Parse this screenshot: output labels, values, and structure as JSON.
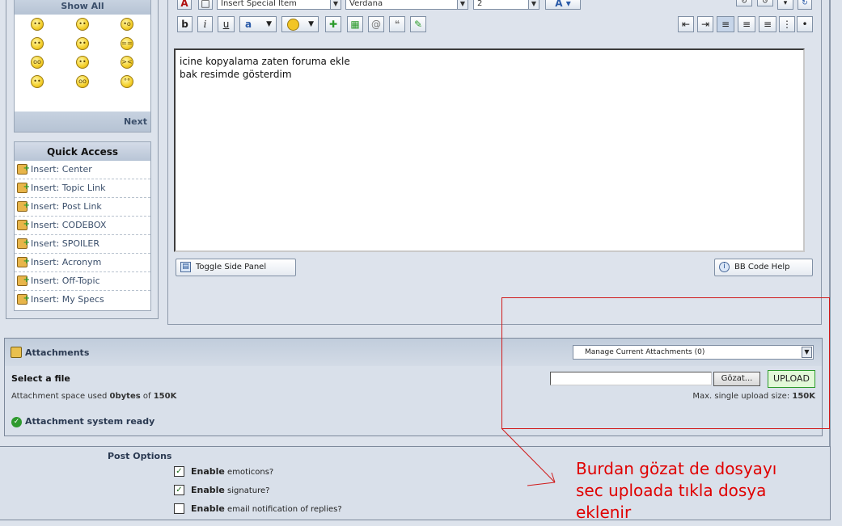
{
  "emoticons": {
    "show_all": "Show All",
    "next": "Next",
    "faces": [
      "••",
      "••",
      "•o",
      "••",
      "••",
      "==",
      "oo",
      "••",
      "><",
      "••",
      "oo",
      "°°"
    ]
  },
  "quick_access": {
    "title": "Quick Access",
    "items": [
      "Insert: Center",
      "Insert: Topic Link",
      "Insert: Post Link",
      "Insert: CODEBOX",
      "Insert: SPOILER",
      "Insert: Acronym",
      "Insert: Off-Topic",
      "Insert: My Specs"
    ]
  },
  "toolbar": {
    "special_item": "Insert Special Item",
    "font": "Verdana",
    "size": "2",
    "bold": "b",
    "italic": "i",
    "underline": "u",
    "font_color": "a"
  },
  "editor": {
    "lines": [
      "icine kopyalama zaten foruma ekle",
      "",
      "bak resimde gösterdim"
    ]
  },
  "buttons": {
    "toggle_side_panel": "Toggle Side Panel",
    "bbcode_help": "BB Code Help"
  },
  "attachments": {
    "title": "Attachments",
    "manage": "Manage Current Attachments (0)",
    "select_file": "Select a file",
    "space_used_prefix": "Attachment space used ",
    "space_used": "0bytes",
    "space_of": " of ",
    "space_total": "150K",
    "browse": "Gözat...",
    "upload": "UPLOAD",
    "max_size_label": "Max. single upload size: ",
    "max_size": "150K",
    "status": "Attachment system ready"
  },
  "post_options": {
    "title": "Post Options",
    "options": [
      {
        "bold": "Enable",
        "text": " emoticons?",
        "checked": true
      },
      {
        "bold": "Enable",
        "text": " signature?",
        "checked": true
      },
      {
        "bold": "Enable",
        "text": " email notification of replies?",
        "checked": false
      }
    ]
  },
  "annotation": {
    "lines": [
      "Burdan gözat de dosyayı",
      "sec uploada tıkla dosya",
      "eklenir"
    ],
    "color": "#e00000"
  }
}
